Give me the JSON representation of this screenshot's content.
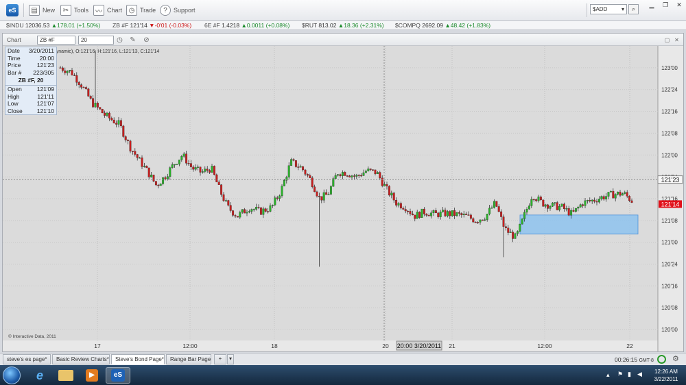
{
  "toolbar": {
    "logo": "eS",
    "new_label": "New",
    "tools_label": "Tools",
    "chart_label": "Chart",
    "trade_label": "Trade",
    "support_label": "Support",
    "search_value": "$ADD"
  },
  "ticker": [
    {
      "sym": "$INDU",
      "price": "12036.53",
      "chg": "178.01 (+1.50%)",
      "dir": "up"
    },
    {
      "sym": "ZB #F",
      "price": "121'14",
      "chg": "-0'01 (-0.03%)",
      "dir": "down"
    },
    {
      "sym": "6E #F",
      "price": "1.4218",
      "chg": "0.0011 (+0.08%)",
      "dir": "up"
    },
    {
      "sym": "$RUT",
      "price": "813.02",
      "chg": "18.36 (+2.31%)",
      "dir": "up"
    },
    {
      "sym": "$COMPQ",
      "price": "2692.09",
      "chg": "48.42 (+1.83%)",
      "dir": "up"
    }
  ],
  "chart_header": {
    "title": "Chart",
    "symbol": "ZB #F",
    "interval": "20"
  },
  "databox": {
    "date_label": "Date",
    "date": "3/20/2011",
    "time_label": "Time",
    "time": "20:00",
    "price_label": "Price",
    "price": "121'23",
    "bar_label": "Bar #",
    "bar": "223/305",
    "series": "ZB #F, 20",
    "open_label": "Open",
    "open": "121'09",
    "high_label": "High",
    "high": "121'11",
    "low_label": "Low",
    "low": "121'07",
    "close_label": "Close",
    "close": "121'10"
  },
  "chart_data": {
    "type": "candlestick",
    "info_line": "T, 20, 00:00-00:00 (Dynamic), O:121'16, H:121'16, L:121'13, C:121'14",
    "copyright": "© Interactive Data, 2011",
    "y_ticks": [
      "123'00",
      "122'24",
      "122'16",
      "122'08",
      "122'00",
      "121'24",
      "121'16",
      "121'08",
      "121'00",
      "120'24",
      "120'16",
      "120'08",
      "120'00"
    ],
    "y_range": [
      "119'28",
      "123'08"
    ],
    "x_ticks": [
      "17",
      "12:00",
      "18",
      "20",
      "21",
      "12:00",
      "22"
    ],
    "crosshair_price_label": "121'23",
    "crosshair_time_label": "20:00 3/20/2011",
    "last_price_label": "121'14",
    "highlight_zone": [
      "121'03",
      "121'10"
    ],
    "colors": {
      "up": "#2bb32b",
      "down": "#c81e1e",
      "zone": "#8ec3ef",
      "last": "#e1111a"
    }
  },
  "tabs": [
    "steve's es page*",
    "Basic Review Charts*",
    "Steve's Bond Page*",
    "Range Bar Page"
  ],
  "active_tab": 2,
  "status": {
    "time": "00:26:15",
    "tz": "GMT-8"
  },
  "taskbar": {
    "time": "12:26 AM",
    "date": "3/22/2011",
    "es_label": "eS"
  }
}
